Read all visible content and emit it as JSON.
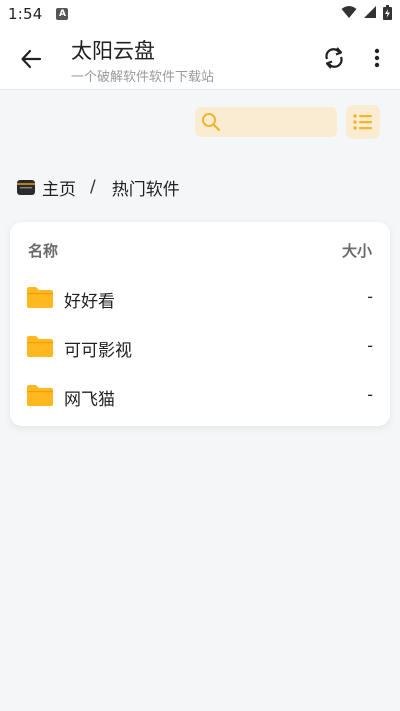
{
  "status_bar": {
    "time": "1:54",
    "notification_badge": "A",
    "icons": [
      "wifi-icon",
      "cell-signal-icon",
      "battery-charging-icon"
    ]
  },
  "app_bar": {
    "title": "太阳云盘",
    "subtitle": "一个破解软件软件下载站",
    "icons": [
      "arrow-left-icon",
      "sync-icon",
      "more-vertical-icon"
    ]
  },
  "toolbar": {
    "search_placeholder": "",
    "search_value": "",
    "view_toggle_icon": "list-icon"
  },
  "breadcrumb": {
    "home": "主页",
    "separator": "/",
    "current": "热门软件"
  },
  "file_list": {
    "header_name": "名称",
    "header_size": "大小",
    "items": [
      {
        "name": "好好看",
        "size": "-",
        "icon": "folder-icon"
      },
      {
        "name": "可可影视",
        "size": "-",
        "icon": "folder-icon"
      },
      {
        "name": "网飞猫",
        "size": "-",
        "icon": "folder-icon"
      }
    ]
  },
  "colors": {
    "accent": "#f5b52a",
    "search_bg": "#faecd3",
    "folder": "#ffb81f",
    "background": "#f5f6f8"
  }
}
